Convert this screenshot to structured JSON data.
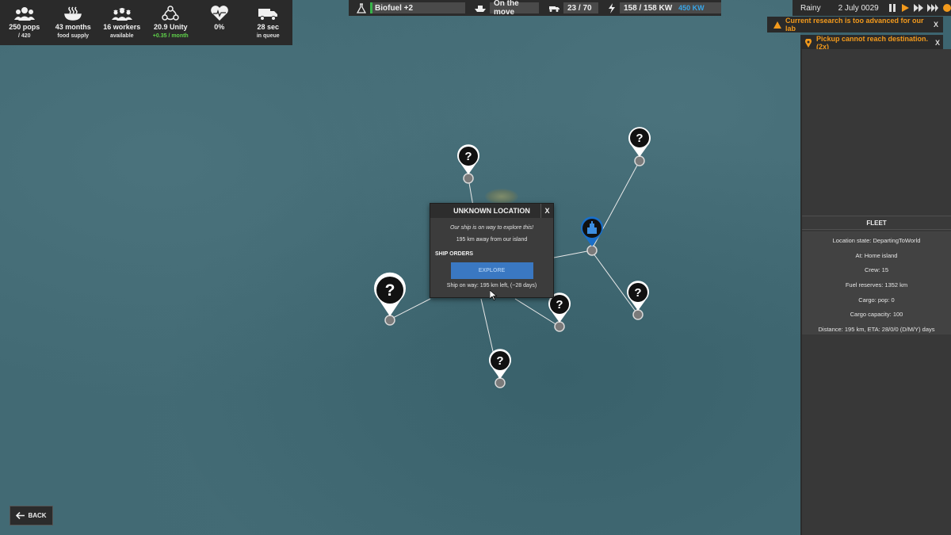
{
  "stats": [
    {
      "icon": "population-icon",
      "value": "250 pops",
      "sub": "/ 420"
    },
    {
      "icon": "food-bowl-icon",
      "value": "43 months",
      "sub": "food supply"
    },
    {
      "icon": "workers-icon",
      "value": "16 workers",
      "sub": "available"
    },
    {
      "icon": "unity-icon",
      "value": "20.9 Unity",
      "sub": "+0.35 / month"
    },
    {
      "icon": "heart-icon",
      "value": "0%",
      "sub": ""
    },
    {
      "icon": "truck-icon",
      "value": "28 sec",
      "sub": "in queue"
    }
  ],
  "topbar": {
    "biofuel": "Biofuel +2",
    "ship_status": "On the move",
    "vehicles": "23 / 70",
    "power": "158 / 158 KW",
    "power_extra": "450 KW"
  },
  "weather": {
    "condition": "Rainy",
    "date": "2 July 0029"
  },
  "notifications": [
    {
      "text": "Current research is too advanced for our lab",
      "close": "X"
    },
    {
      "text": "Pickup cannot reach destination. (2x)",
      "close": "X"
    }
  ],
  "fleet": {
    "header": "FLEET",
    "lines": [
      "Location state: DepartingToWorld",
      "At: Home island",
      "Crew: 15",
      "Fuel reserves: 1352 km",
      "Cargo: pop: 0",
      "Cargo capacity: 100",
      "Distance: 195 km, ETA: 28/0/0 (D/M/Y) days"
    ]
  },
  "popup": {
    "title": "UNKNOWN LOCATION",
    "close": "X",
    "line1": "Our ship is on way to explore this!",
    "line2": "195 km away from our island",
    "orders_label": "SHIP ORDERS",
    "explore_label": "EXPLORE",
    "way_text": "Ship on way: 195 km left, (~28 days)"
  },
  "markers": {
    "unknown_glyph": "?"
  },
  "back_label": "BACK",
  "colors": {
    "accent_orange": "#f39a1c",
    "unity_green": "#5fd24a",
    "power_blue": "#39a6e8",
    "explore_blue": "#3a78c2",
    "home_pin_blue": "#1a6fc9"
  }
}
